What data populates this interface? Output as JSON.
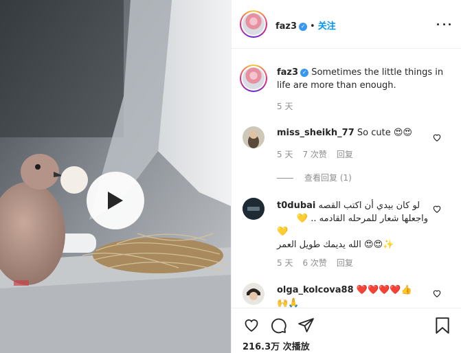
{
  "header": {
    "username": "faz3",
    "follow_label": "关注",
    "separator": "•"
  },
  "caption": {
    "username": "faz3",
    "text_line1": "Sometimes the little things in",
    "text_line2": "life are more than enough.",
    "time": "5 天"
  },
  "comments": [
    {
      "username": "miss_sheikh_77",
      "text": "So cute 😍😍",
      "time": "5 天",
      "likes": "7 次赞",
      "reply_label": "回复",
      "view_replies": "查看回复 (1)"
    },
    {
      "username": "t0dubai",
      "line1": "لو كان بيدي أن اكتب القصه",
      "line2": "واجعلها شعار للمرحله القادمه ..",
      "emoji1": "💛",
      "emoji2": "💛",
      "line3": "الله يديمك طويل العمر",
      "line3_emoji": "😍😍✨",
      "time": "5 天",
      "likes": "6 次赞",
      "reply_label": "回复"
    },
    {
      "username": "olga_kolcova88",
      "text": "❤️❤️❤️❤️👍",
      "text2": "🙌🙏"
    }
  ],
  "footer": {
    "views": "216.3万 次播放"
  },
  "colors": {
    "accent": "#0095f6",
    "verified": "#3897f0",
    "muted": "#8e8e8e"
  },
  "icons": [
    "play-icon",
    "verified-icon",
    "more-icon",
    "heart-icon",
    "comment-icon",
    "share-icon",
    "bookmark-icon"
  ]
}
